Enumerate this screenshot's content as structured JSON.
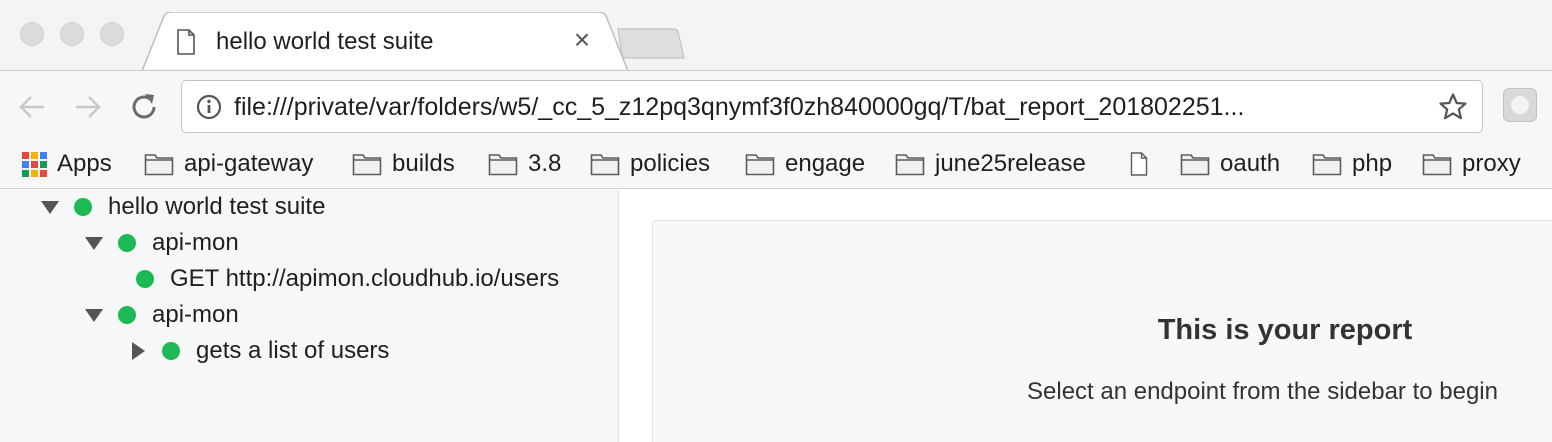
{
  "browser": {
    "tab": {
      "title": "hello world test suite",
      "close_glyph": "×"
    },
    "address_bar": {
      "url": "file:///private/var/folders/w5/_cc_5_z12pq3qnymf3f0zh840000gq/T/bat_report_201802251..."
    },
    "bookmarks": [
      {
        "label": "Apps",
        "icon": "apps-grid-icon"
      },
      {
        "label": "api-gateway",
        "icon": "folder-icon"
      },
      {
        "label": "builds",
        "icon": "folder-icon"
      },
      {
        "label": "3.8",
        "icon": "folder-icon"
      },
      {
        "label": "policies",
        "icon": "folder-icon"
      },
      {
        "label": "engage",
        "icon": "folder-icon"
      },
      {
        "label": "june25release",
        "icon": "folder-icon"
      },
      {
        "label": "",
        "icon": "page-icon"
      },
      {
        "label": "oauth",
        "icon": "folder-icon"
      },
      {
        "label": "php",
        "icon": "folder-icon"
      },
      {
        "label": "proxy",
        "icon": "folder-icon"
      }
    ]
  },
  "sidebar": {
    "tree": [
      {
        "label": "hello world test suite",
        "expanded": true,
        "status": "pass"
      },
      {
        "label": "api-mon",
        "expanded": true,
        "status": "pass"
      },
      {
        "label": "GET http://apimon.cloudhub.io/users",
        "status": "pass"
      },
      {
        "label": "api-mon",
        "expanded": true,
        "status": "pass"
      },
      {
        "label": "gets a list of users",
        "expanded": false,
        "status": "pass"
      }
    ]
  },
  "main": {
    "title": "This is your report",
    "subtitle": "Select an endpoint from the sidebar to begin"
  },
  "colors": {
    "status_pass": "#1cb955"
  }
}
